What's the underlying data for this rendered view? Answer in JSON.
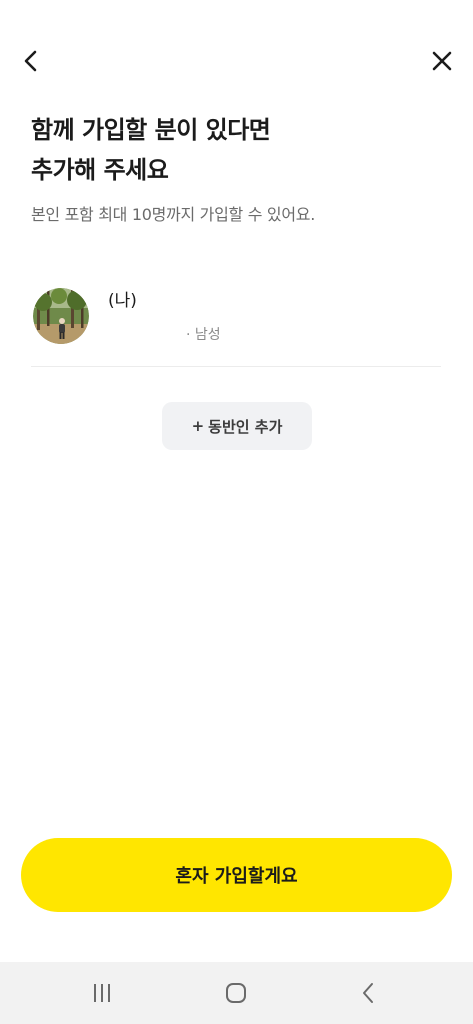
{
  "header": {
    "back_icon": "chevron-left-icon",
    "close_icon": "close-icon"
  },
  "title": {
    "line1": "함께 가입할 분이 있다면",
    "line2": "추가해 주세요"
  },
  "subtitle": "본인 포함 최대 10명까지 가입할 수 있어요.",
  "member": {
    "name": "(나)",
    "detail": "· 남성",
    "avatar_icon": "profile-photo"
  },
  "add_companion": {
    "plus": "+",
    "label": "동반인 추가"
  },
  "primary_button": {
    "label": "혼자 가입할게요"
  },
  "nav_bar": {
    "recents_icon": "recent-apps-icon",
    "home_icon": "home-icon",
    "back_icon": "back-icon"
  },
  "colors": {
    "accent": "#ffe600",
    "title_text": "#1b1b1b",
    "secondary_text": "#6b6b6b",
    "chip_bg": "#f1f2f4",
    "nav_bg": "#f2f2f2"
  }
}
